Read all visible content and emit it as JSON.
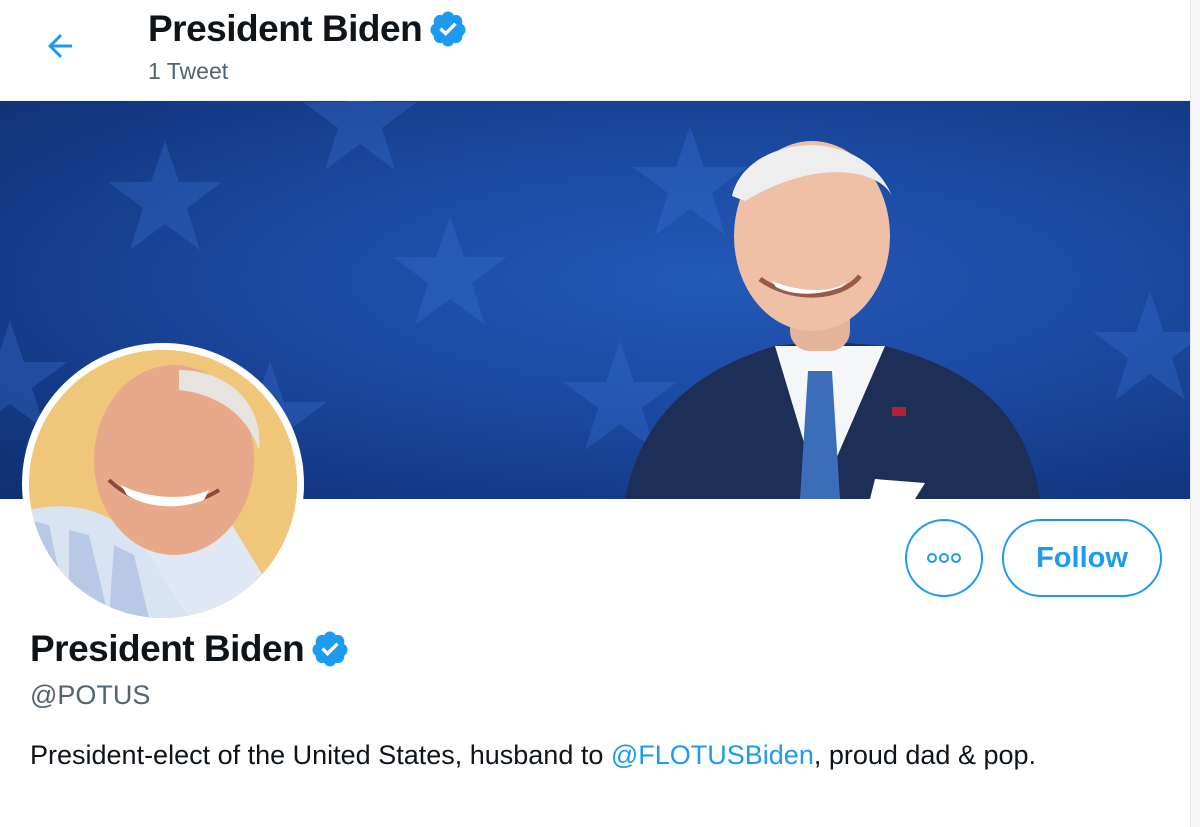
{
  "header": {
    "display_name": "President Biden",
    "tweet_count_label": "1 Tweet"
  },
  "profile": {
    "display_name": "President Biden",
    "handle": "@POTUS",
    "bio": {
      "before": "President-elect of the United States, husband to ",
      "mention": "@FLOTUSBiden",
      "after": ", proud dad & pop."
    }
  },
  "actions": {
    "follow_label": "Follow",
    "more_icon": "more-horizontal-icon"
  },
  "icons": {
    "back": "arrow-left-icon",
    "verified": "verified-badge-icon"
  },
  "colors": {
    "accent": "#1d9bf0",
    "text_primary": "#0f1419",
    "text_secondary": "#536471",
    "banner_blue": "#1c4aa2",
    "avatar_bg": "#f0c77a"
  }
}
